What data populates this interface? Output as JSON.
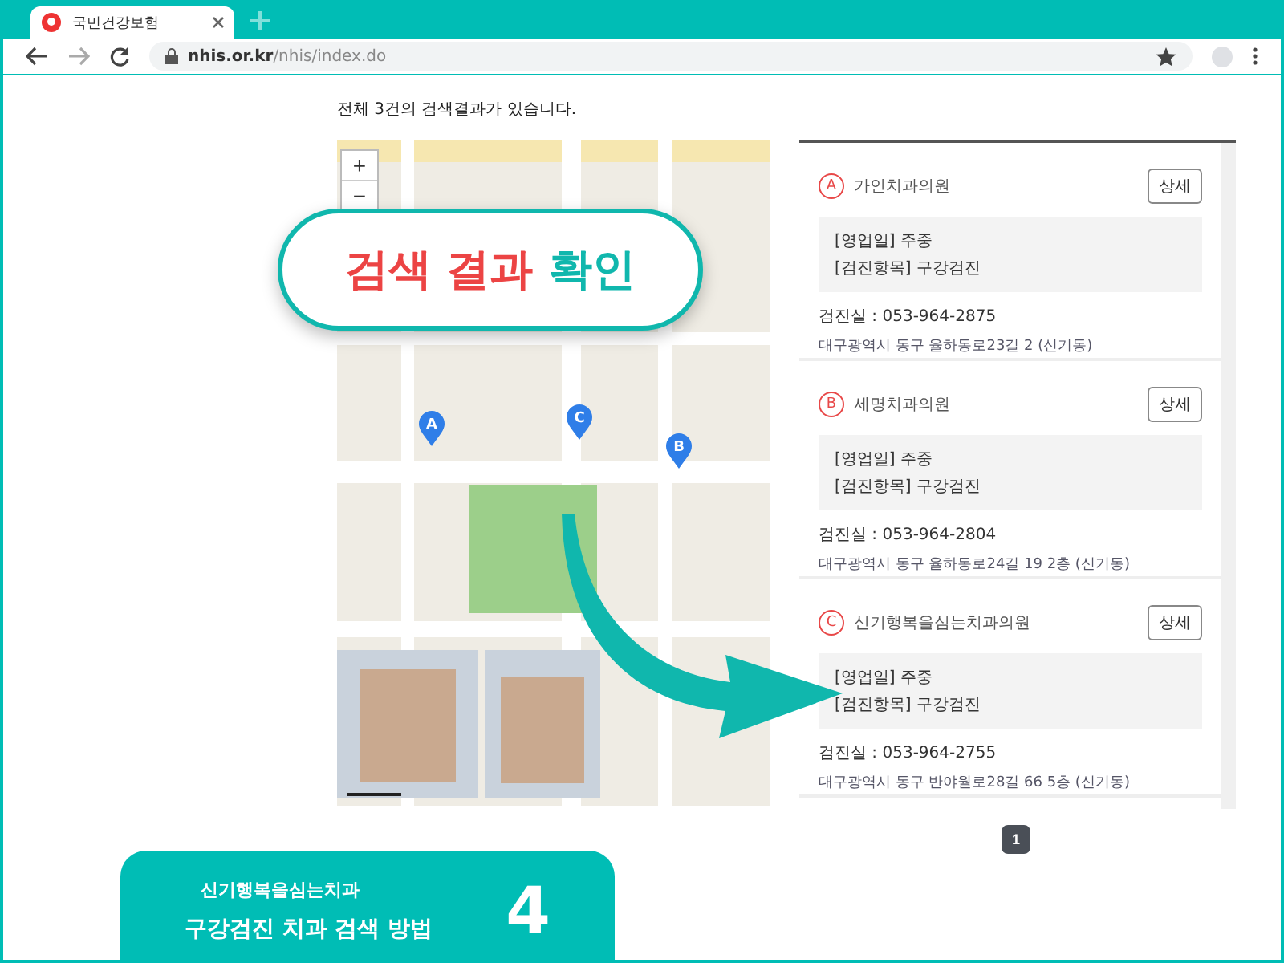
{
  "browser": {
    "tab_title": "국민건강보험",
    "url_host": "nhis.or.kr",
    "url_path": "/nhis/index.do"
  },
  "summary": "전체 3건의 검색결과가 있습니다.",
  "map": {
    "zoom_in": "+",
    "zoom_out": "−",
    "markers": [
      {
        "letter": "A"
      },
      {
        "letter": "C"
      },
      {
        "letter": "B"
      }
    ]
  },
  "results": [
    {
      "letter": "A",
      "name": "가인치과의원",
      "detail_button": "상세",
      "hours": "[영업일] 주중",
      "items": "[검진항목] 구강검진",
      "phone": "검진실 : 053-964-2875",
      "address": "대구광역시 동구 율하동로23길 2 (신기동)"
    },
    {
      "letter": "B",
      "name": "세명치과의원",
      "detail_button": "상세",
      "hours": "[영업일] 주중",
      "items": "[검진항목] 구강검진",
      "phone": "검진실 : 053-964-2804",
      "address": "대구광역시 동구 율하동로24길 19 2층 (신기동)"
    },
    {
      "letter": "C",
      "name": "신기행복을심는치과의원",
      "detail_button": "상세",
      "hours": "[영업일] 주중",
      "items": "[검진항목] 구강검진",
      "phone": "검진실 : 053-964-2755",
      "address": "대구광역시 동구 반야월로28길 66 5층 (신기동)"
    }
  ],
  "pagination": [
    {
      "label": "1",
      "selected": true
    }
  ],
  "callout": {
    "parts": [
      {
        "text": "검색 결과",
        "color": "#ec4444"
      },
      {
        "text": "확인",
        "color": "#10b7ad"
      }
    ]
  },
  "badge": {
    "subtitle": "신기행복을심는치과",
    "title": "구강검진 치과 검색 방법",
    "number": "4"
  }
}
